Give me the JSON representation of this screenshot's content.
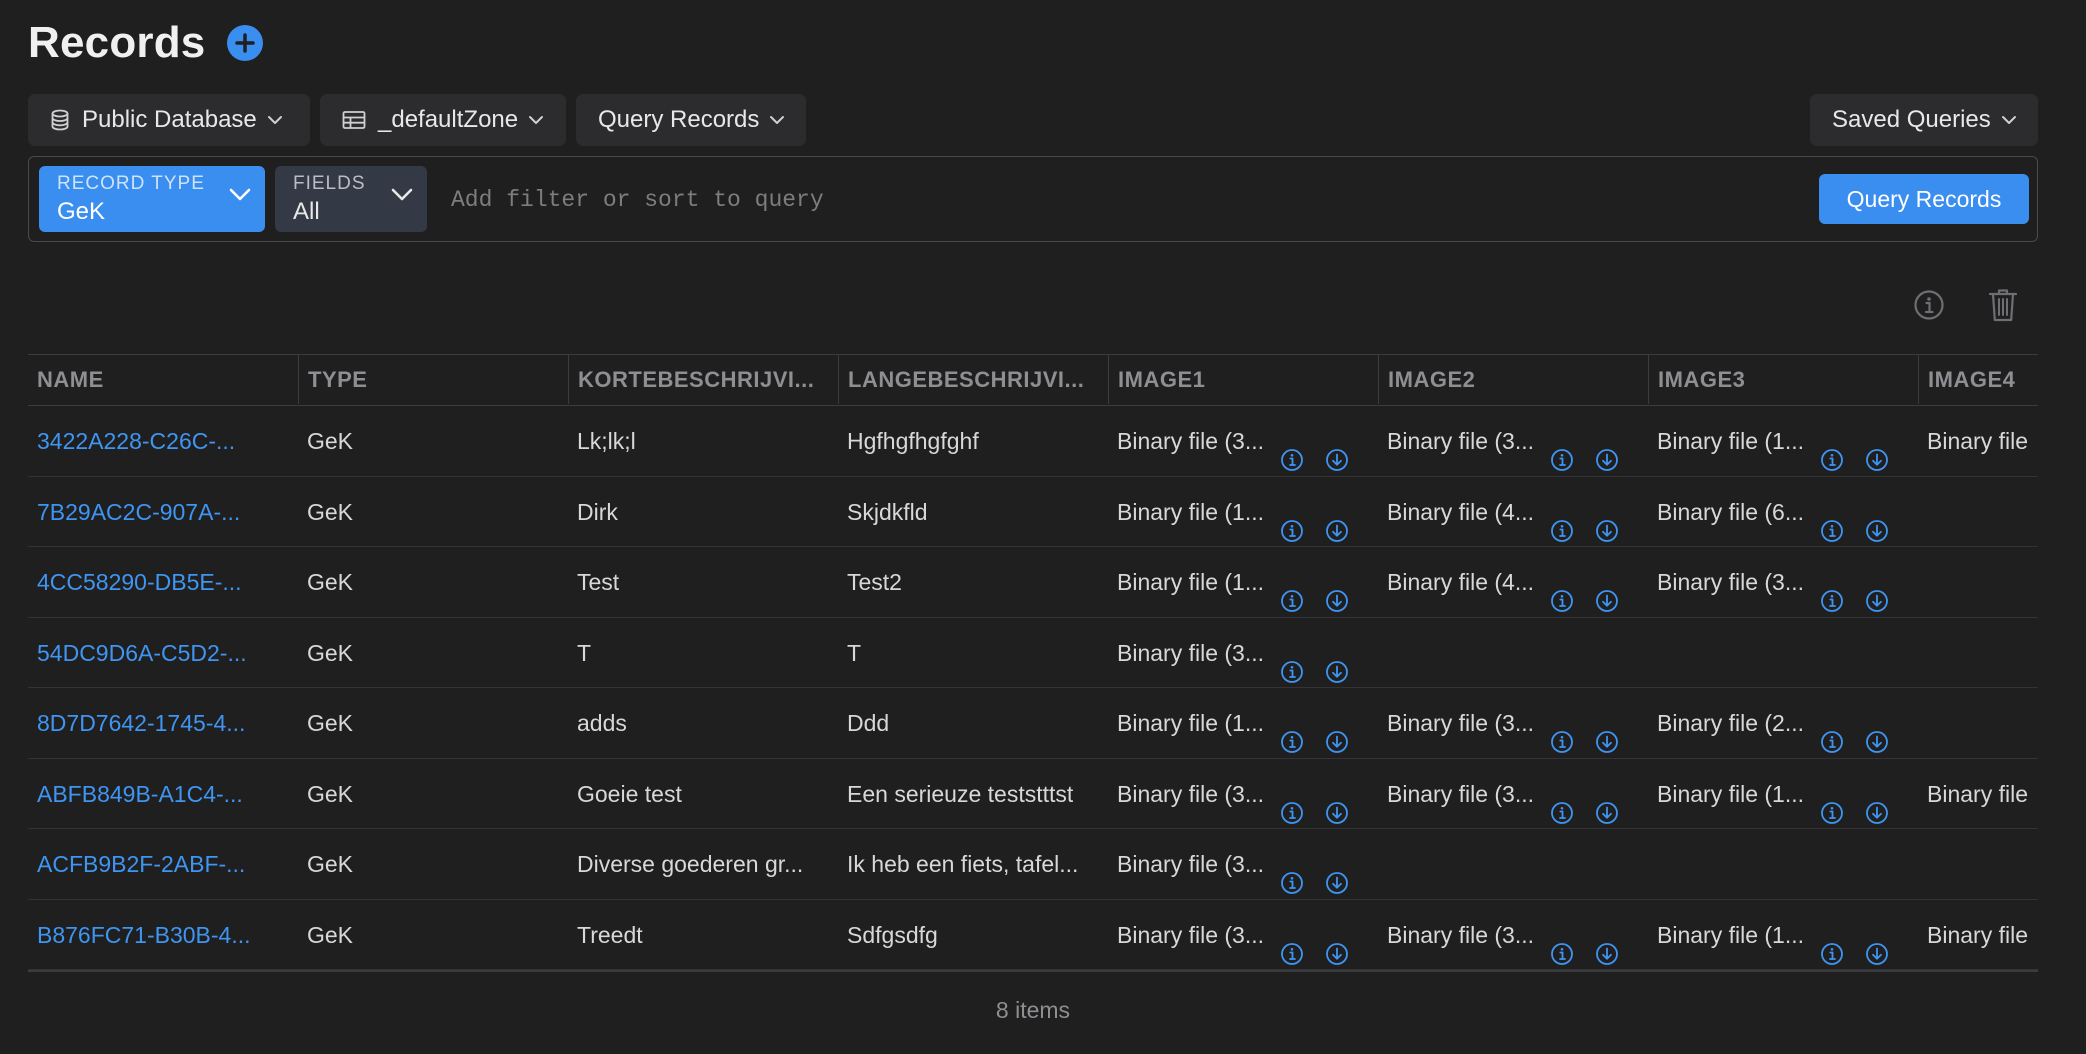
{
  "page": {
    "title": "Records"
  },
  "toolbar": {
    "database": "Public Database",
    "zone": "_defaultZone",
    "query": "Query Records",
    "saved_queries": "Saved Queries"
  },
  "query_bar": {
    "record_type_label": "RECORD TYPE",
    "record_type_value": "GeK",
    "fields_label": "FIELDS",
    "fields_value": "All",
    "filter_placeholder": "Add filter or sort to query",
    "submit_label": "Query Records"
  },
  "table": {
    "columns": [
      "NAME",
      "TYPE",
      "KORTEBESCHRIJVI...",
      "LANGEBESCHRIJVI...",
      "IMAGE1",
      "IMAGE2",
      "IMAGE3",
      "IMAGE4"
    ],
    "rows": [
      {
        "name": "3422A228-C26C-...",
        "type": "GeK",
        "kort": "Lk;lk;l",
        "lang": "Hgfhgfhgfghf",
        "image1": "Binary file (3...",
        "image2": "Binary file (3...",
        "image3": "Binary file (1...",
        "image4": "Binary file"
      },
      {
        "name": "7B29AC2C-907A-...",
        "type": "GeK",
        "kort": "Dirk",
        "lang": "Skjdkfld",
        "image1": "Binary file (1...",
        "image2": "Binary file (4...",
        "image3": "Binary file (6...",
        "image4": ""
      },
      {
        "name": "4CC58290-DB5E-...",
        "type": "GeK",
        "kort": "Test",
        "lang": "Test2",
        "image1": "Binary file (1...",
        "image2": "Binary file (4...",
        "image3": "Binary file (3...",
        "image4": ""
      },
      {
        "name": "54DC9D6A-C5D2-...",
        "type": "GeK",
        "kort": "T",
        "lang": "T",
        "image1": "Binary file (3...",
        "image2": "",
        "image3": "",
        "image4": ""
      },
      {
        "name": "8D7D7642-1745-4...",
        "type": "GeK",
        "kort": "adds",
        "lang": "Ddd",
        "image1": "Binary file (1...",
        "image2": "Binary file (3...",
        "image3": "Binary file (2...",
        "image4": ""
      },
      {
        "name": "ABFB849B-A1C4-...",
        "type": "GeK",
        "kort": "Goeie test",
        "lang": "Een serieuze teststttst",
        "image1": "Binary file (3...",
        "image2": "Binary file (3...",
        "image3": "Binary file (1...",
        "image4": "Binary file"
      },
      {
        "name": "ACFB9B2F-2ABF-...",
        "type": "GeK",
        "kort": "Diverse goederen gr...",
        "lang": "Ik heb een fiets, tafel...",
        "image1": "Binary file (3...",
        "image2": "",
        "image3": "",
        "image4": ""
      },
      {
        "name": "B876FC71-B30B-4...",
        "type": "GeK",
        "kort": "Treedt",
        "lang": "Sdfgsdfg",
        "image1": "Binary file (3...",
        "image2": "Binary file (3...",
        "image3": "Binary file (1...",
        "image4": "Binary file"
      }
    ]
  },
  "footer": {
    "count": "8 items"
  },
  "colors": {
    "accent": "#3a8eef",
    "link": "#3f95f2",
    "background": "#1f1f1f"
  },
  "icons": [
    "plus-icon",
    "database-icon",
    "table-icon",
    "chevron-down-icon",
    "info-icon",
    "trash-icon",
    "download-icon"
  ]
}
